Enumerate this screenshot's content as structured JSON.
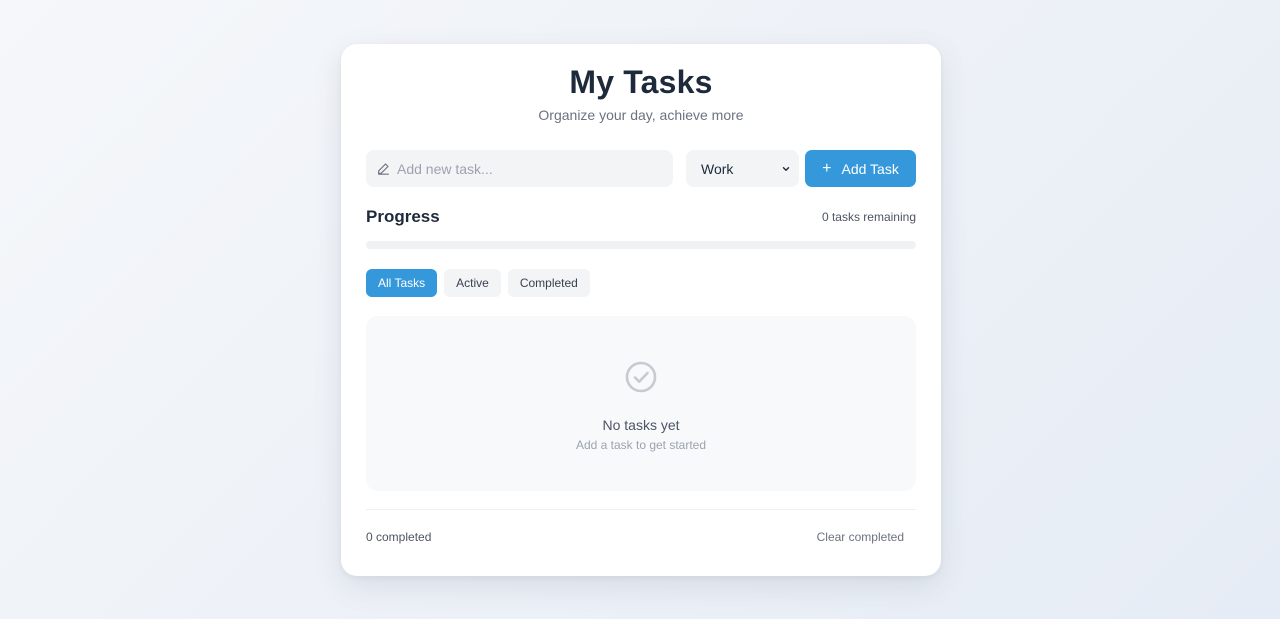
{
  "header": {
    "title": "My Tasks",
    "subtitle": "Organize your day, achieve more"
  },
  "new_task": {
    "placeholder": "Add new task...",
    "value": "",
    "icon": "pencil-icon",
    "category_selected": "Work",
    "add_button_label": "Add Task",
    "add_button_icon": "plus-icon"
  },
  "progress": {
    "title": "Progress",
    "remaining_text": "0 tasks remaining",
    "percent": 0
  },
  "filters": [
    {
      "label": "All Tasks",
      "active": true
    },
    {
      "label": "Active",
      "active": false
    },
    {
      "label": "Completed",
      "active": false
    }
  ],
  "empty_state": {
    "icon": "check-circle-icon",
    "title": "No tasks yet",
    "subtitle": "Add a task to get started"
  },
  "footer": {
    "completed_text": "0 completed",
    "clear_label": "Clear completed"
  },
  "colors": {
    "accent": "#3498db",
    "text_dark": "#1e2a3b",
    "text_muted": "#6b7280"
  }
}
